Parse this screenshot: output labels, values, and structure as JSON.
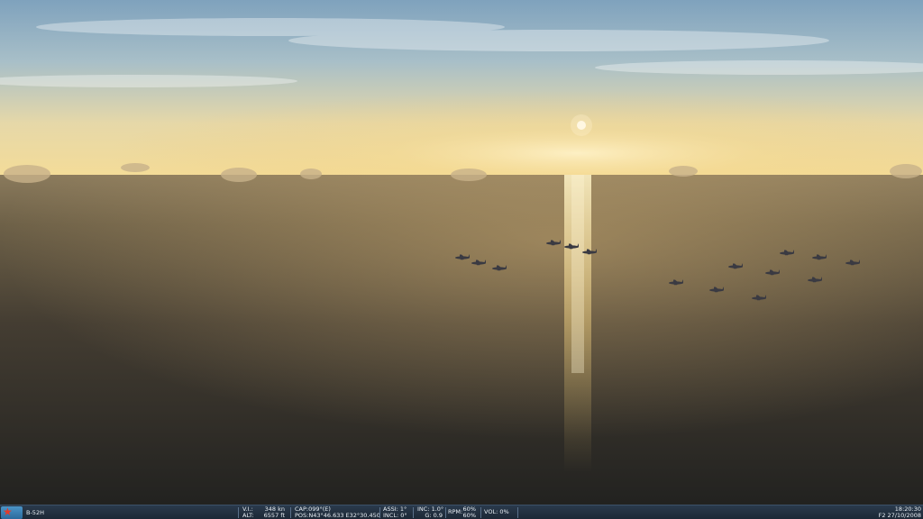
{
  "scene": {
    "description_icons": [
      "sun",
      "aircraft-formation",
      "sea",
      "clouds"
    ],
    "colors": {
      "sky_top": "#8fb0c8",
      "horizon_glow": "#f2d99a",
      "sea_far": "#7a6a50",
      "sea_near": "#262624",
      "sun": "#fff8e6",
      "aircraft": "#3a3a40"
    }
  },
  "statusbar": {
    "unit_icon": "red-star-icon",
    "unit_name": "B-52H",
    "vi_label": "V.I.:",
    "vi_value": "348 kn",
    "alt_label": "ALT:",
    "alt_value": "6557 ft",
    "cap": "CAP:099°(E)",
    "pos": "POS:N43°46.633 E32°30.450",
    "assi": "ASSI: 1°",
    "incl": "INCL: 0°",
    "inc": "INC: 1.0°",
    "g": "G: 0.9",
    "rpm_label": "RPM:",
    "rpm_1": "60%",
    "rpm_2": "60%",
    "vol": "VOL: 0%",
    "time": "18:20:30",
    "date": "F2 27/10/2008"
  }
}
